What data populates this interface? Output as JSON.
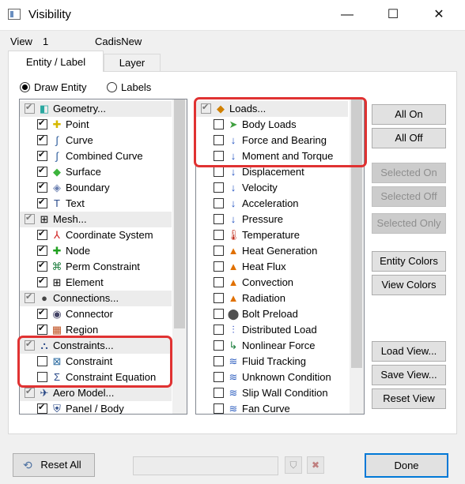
{
  "window": {
    "title": "Visibility",
    "minimize": "—",
    "maximize": "☐",
    "close": "✕"
  },
  "info": {
    "view_label": "View",
    "view_number": "1",
    "view_name": "CadisNew"
  },
  "tabs": [
    {
      "label": "Entity / Label"
    },
    {
      "label": "Layer"
    }
  ],
  "radios": {
    "draw_entity": "Draw Entity",
    "labels": "Labels"
  },
  "left_list": [
    {
      "label": "Geometry...",
      "group": true
    },
    {
      "label": "Point"
    },
    {
      "label": "Curve"
    },
    {
      "label": "Combined Curve"
    },
    {
      "label": "Surface"
    },
    {
      "label": "Boundary"
    },
    {
      "label": "Text"
    },
    {
      "label": "Mesh...",
      "group": true
    },
    {
      "label": "Coordinate System"
    },
    {
      "label": "Node"
    },
    {
      "label": "Perm Constraint"
    },
    {
      "label": "Element"
    },
    {
      "label": "Connections...",
      "group": true
    },
    {
      "label": "Connector"
    },
    {
      "label": "Region"
    },
    {
      "label": "Constraints...",
      "group": true
    },
    {
      "label": "Constraint"
    },
    {
      "label": "Constraint Equation"
    },
    {
      "label": "Aero Model...",
      "group": true
    },
    {
      "label": "Panel / Body"
    }
  ],
  "right_list": [
    {
      "label": "Loads...",
      "group": true
    },
    {
      "label": "Body Loads"
    },
    {
      "label": "Force and Bearing"
    },
    {
      "label": "Moment and Torque"
    },
    {
      "label": "Displacement"
    },
    {
      "label": "Velocity"
    },
    {
      "label": "Acceleration"
    },
    {
      "label": "Pressure"
    },
    {
      "label": "Temperature"
    },
    {
      "label": "Heat Generation"
    },
    {
      "label": "Heat Flux"
    },
    {
      "label": "Convection"
    },
    {
      "label": "Radiation"
    },
    {
      "label": "Bolt Preload"
    },
    {
      "label": "Distributed Load"
    },
    {
      "label": "Nonlinear Force"
    },
    {
      "label": "Fluid Tracking"
    },
    {
      "label": "Unknown Condition"
    },
    {
      "label": "Slip Wall Condition"
    },
    {
      "label": "Fan Curve"
    }
  ],
  "buttons": {
    "all_on": "All On",
    "all_off": "All Off",
    "selected_on": "Selected On",
    "selected_off": "Selected Off",
    "selected_only": "Selected Only",
    "entity_colors": "Entity Colors",
    "view_colors": "View Colors",
    "load_view": "Load View...",
    "save_view": "Save View...",
    "reset_view": "Reset View",
    "reset_all": "Reset All",
    "done": "Done"
  },
  "colors": {
    "highlight": "#e03232",
    "accent": "#0078d7"
  }
}
